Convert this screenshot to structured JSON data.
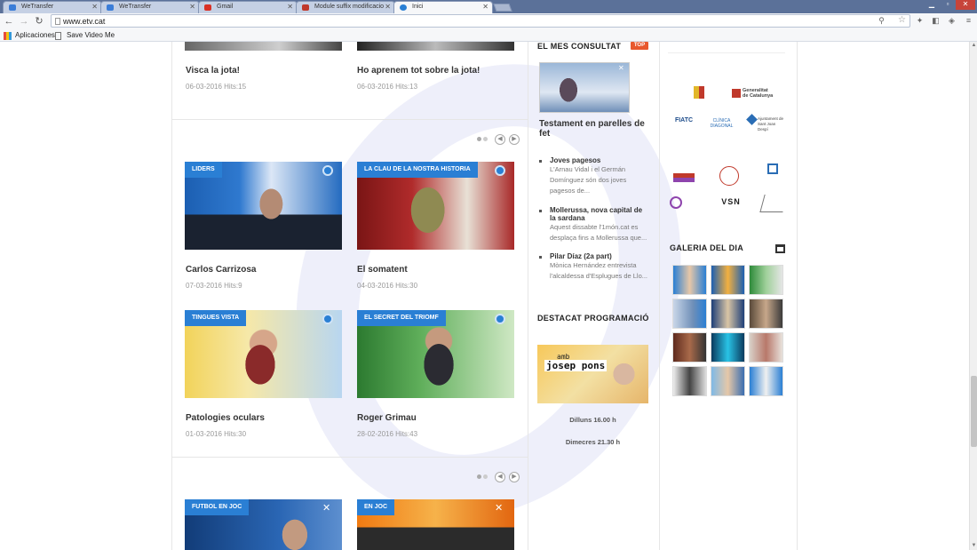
{
  "browser": {
    "tabs": [
      {
        "label": "WeTransfer",
        "color": "#3b7dd8"
      },
      {
        "label": "WeTransfer",
        "color": "#3b7dd8"
      },
      {
        "label": "Gmail",
        "color": "#d93025"
      },
      {
        "label": "Module suffix modificacio",
        "color": "#c0392b"
      },
      {
        "label": "Inici",
        "color": "#2a7fd4"
      }
    ],
    "url": "www.etv.cat",
    "bookmarks": [
      "Aplicaciones",
      "Save Video Me"
    ]
  },
  "videos": {
    "row1": [
      {
        "title": "Visca la jota!",
        "meta": "06-03-2016 Hits:15"
      },
      {
        "title": "Ho aprenem tot sobre la jota!",
        "meta": "06-03-2016 Hits:13"
      }
    ],
    "row2": [
      {
        "category": "LIDERS",
        "title": "Carlos Carrizosa",
        "meta": "07-03-2016 Hits:9"
      },
      {
        "category": "LA CLAU DE LA NOSTRA HISTORIA",
        "title": "El somatent",
        "meta": "04-03-2016 Hits:30"
      }
    ],
    "row3": [
      {
        "category": "TINGUES VISTA",
        "title": "Patologies oculars",
        "meta": "01-03-2016 Hits:30"
      },
      {
        "category": "EL SECRET DEL TRIOMF",
        "title": "Roger Grimau",
        "meta": "28-02-2016 Hits:43"
      }
    ],
    "row4": [
      {
        "category": "FUTBOL EN JOC"
      },
      {
        "category": "EN JOC"
      }
    ]
  },
  "sidebar": {
    "mes_consultat": {
      "heading": "EL MES CONSULTAT",
      "badge": "TOP",
      "featured_title": "Testament en parelles de fet",
      "items": [
        {
          "title": "Joves pagesos",
          "desc": "L'Arnau Vidal i el Germán Domínguez són dos joves pagesos de..."
        },
        {
          "title": "Mollerussa, nova capital de la sardana",
          "desc": "Aquest dissabte l'1món.cat es desplaça fins a Mollerussa que..."
        },
        {
          "title": "Pilar Díaz (2a part)",
          "desc": "Mònica Hernández entrevista l'alcaldessa d'Esplugues de Llo..."
        }
      ]
    },
    "programacio": {
      "heading": "DESTACAT PROGRAMACIÓ",
      "show_line1": "amb",
      "show_line2": "josep pons",
      "schedule": [
        "Dilluns 16.00 h",
        "Dimecres 21.30 h"
      ]
    },
    "sponsors": {
      "gencat": "Generalitat de Catalunya",
      "fiatc": "FIATC",
      "diagonal": "CLÍNICA DIAGONAL",
      "ajuntament": "Ajuntament de Sant Joan Despí",
      "vsn": "VSN"
    },
    "galeria": {
      "heading": "GALERIA DEL DIA"
    }
  }
}
